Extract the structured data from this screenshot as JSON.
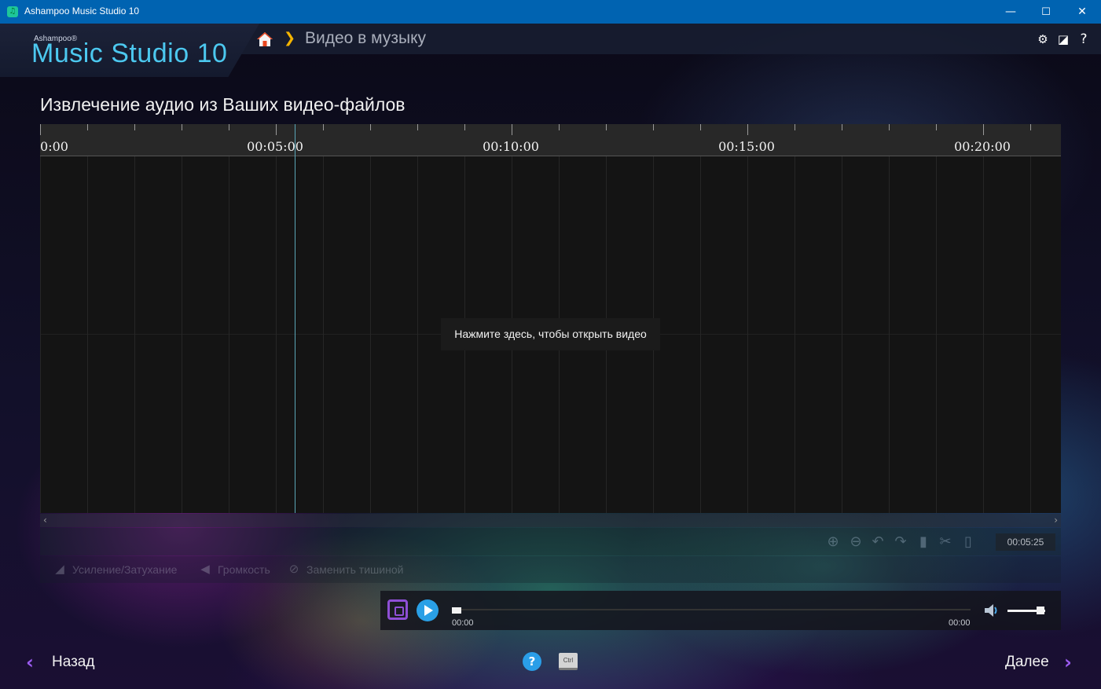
{
  "window": {
    "title": "Ashampoo Music Studio 10",
    "minimize": "—",
    "maximize": "☐",
    "close": "✕"
  },
  "brand": {
    "vendor": "Ashampoo®",
    "product": "Music Studio 10"
  },
  "breadcrumb": {
    "home_icon": "home-icon",
    "separator": "❯",
    "current": "Видео в музыку"
  },
  "header_icons": [
    "gear-icon",
    "notes-icon",
    "help-icon"
  ],
  "header_icon_glyphs": {
    "settings": "⚙",
    "notes": "◪",
    "help": "?"
  },
  "page": {
    "title": "Извлечение аудио из Ваших видео-файлов"
  },
  "timeline": {
    "labels": [
      "0:00",
      "00:05:00",
      "00:10:00",
      "00:15:00",
      "00:20:00"
    ],
    "open_video_prompt": "Нажмите здесь, чтобы открыть видео",
    "scroll_left": "‹",
    "scroll_right": "›"
  },
  "tools": {
    "timecode": "00:05:25",
    "icons": [
      "zoom-in-icon",
      "zoom-out-icon",
      "undo-icon",
      "redo-icon",
      "copy-icon",
      "cut-icon",
      "paste-icon"
    ],
    "effects": [
      {
        "label": "Усиление/Затухание",
        "icon": "fade-icon"
      },
      {
        "label": "Громкость",
        "icon": "volume-effect-icon"
      },
      {
        "label": "Заменить тишиной",
        "icon": "silence-icon"
      }
    ]
  },
  "player": {
    "time_start": "00:00",
    "time_end": "00:00",
    "volume": 0.85,
    "position": 0
  },
  "footer": {
    "back_label": "Назад",
    "next_label": "Далее",
    "help_glyph": "?",
    "ctrl_label": "Ctrl",
    "back_chevron": "‹",
    "next_chevron": "›"
  },
  "colors": {
    "titlebar": "#0063b1",
    "brand": "#4cc8ef",
    "accent": "#9b5bf0",
    "play": "#2aa0e6",
    "breadcrumb_chevron": "#f4b400"
  }
}
